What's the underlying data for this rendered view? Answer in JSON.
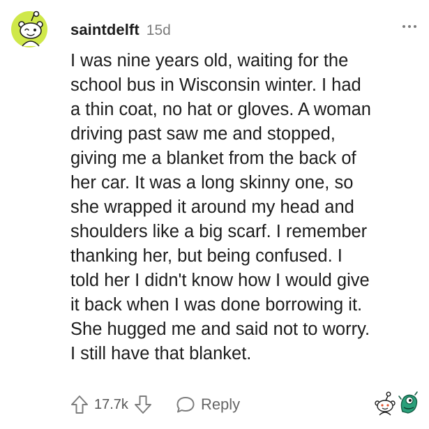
{
  "comment": {
    "username": "saintdelft",
    "timestamp": "15d",
    "avatar_icon": "snoo-avatar-icon",
    "more_icon": "more-options-icon",
    "body_lines": [
      "I was nine years old, waiting for the",
      "school bus in Wisconsin winter. I had",
      "a thin coat, no hat or gloves. A woman",
      "driving past saw me and stopped,",
      "giving me a blanket from the back of",
      "her car. It was a long skinny one, so",
      "she wrapped it around my head and",
      "shoulders like a big scarf. I remember",
      "thanking her, but being confused. I",
      "told her I didn't know how I would give",
      "it back when I was done borrowing it.",
      "She hugged me and said not to worry.",
      "I still have that blanket."
    ]
  },
  "actions": {
    "upvote_icon": "upvote-arrow-icon",
    "vote_count": "17.7k",
    "downvote_icon": "downvote-arrow-icon",
    "reply_icon": "speech-bubble-icon",
    "reply_label": "Reply"
  },
  "awards": [
    "snoo-award-icon",
    "green-creature-award-icon"
  ],
  "colors": {
    "avatar_background": "#cfe84a",
    "text_primary": "#1c1c1c",
    "text_secondary": "#7c7c7c",
    "award_green": "#2aa07a"
  }
}
